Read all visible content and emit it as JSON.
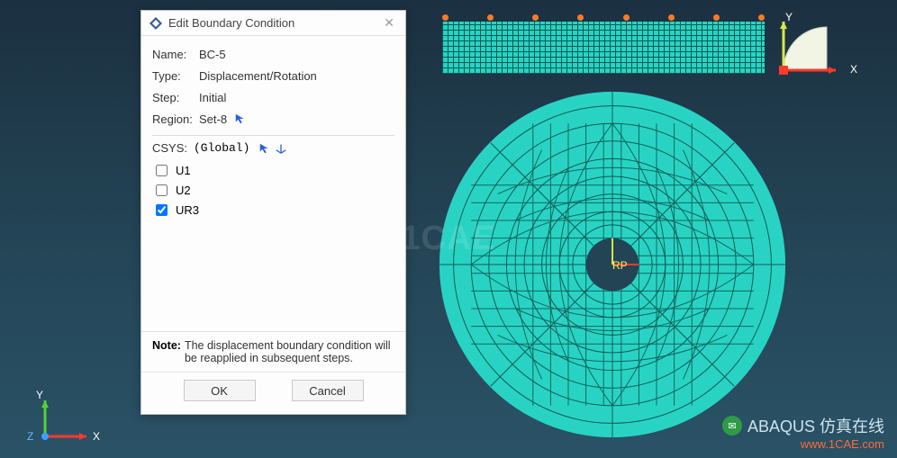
{
  "dialog": {
    "title": "Edit Boundary Condition",
    "name_lbl": "Name:",
    "name_val": "BC-5",
    "type_lbl": "Type:",
    "type_val": "Displacement/Rotation",
    "step_lbl": "Step:",
    "step_val": "Initial",
    "region_lbl": "Region:",
    "region_val": "Set-8",
    "csys_lbl": "CSYS:",
    "csys_val": "(Global)",
    "dof": {
      "u1": {
        "label": "U1",
        "checked": false
      },
      "u2": {
        "label": "U2",
        "checked": false
      },
      "ur3": {
        "label": "UR3",
        "checked": true
      }
    },
    "note_lbl": "Note:",
    "note_text": "The displacement boundary condition will be reapplied in subsequent steps.",
    "ok": "OK",
    "cancel": "Cancel"
  },
  "scene": {
    "axis_x": "X",
    "axis_y": "Y",
    "axis_z": "Z",
    "rp_label": "RP",
    "watermark_center": "1CAE",
    "watermark_text1": "ABAQUS 仿真在线",
    "watermark_url": "www.1CAE.com"
  }
}
